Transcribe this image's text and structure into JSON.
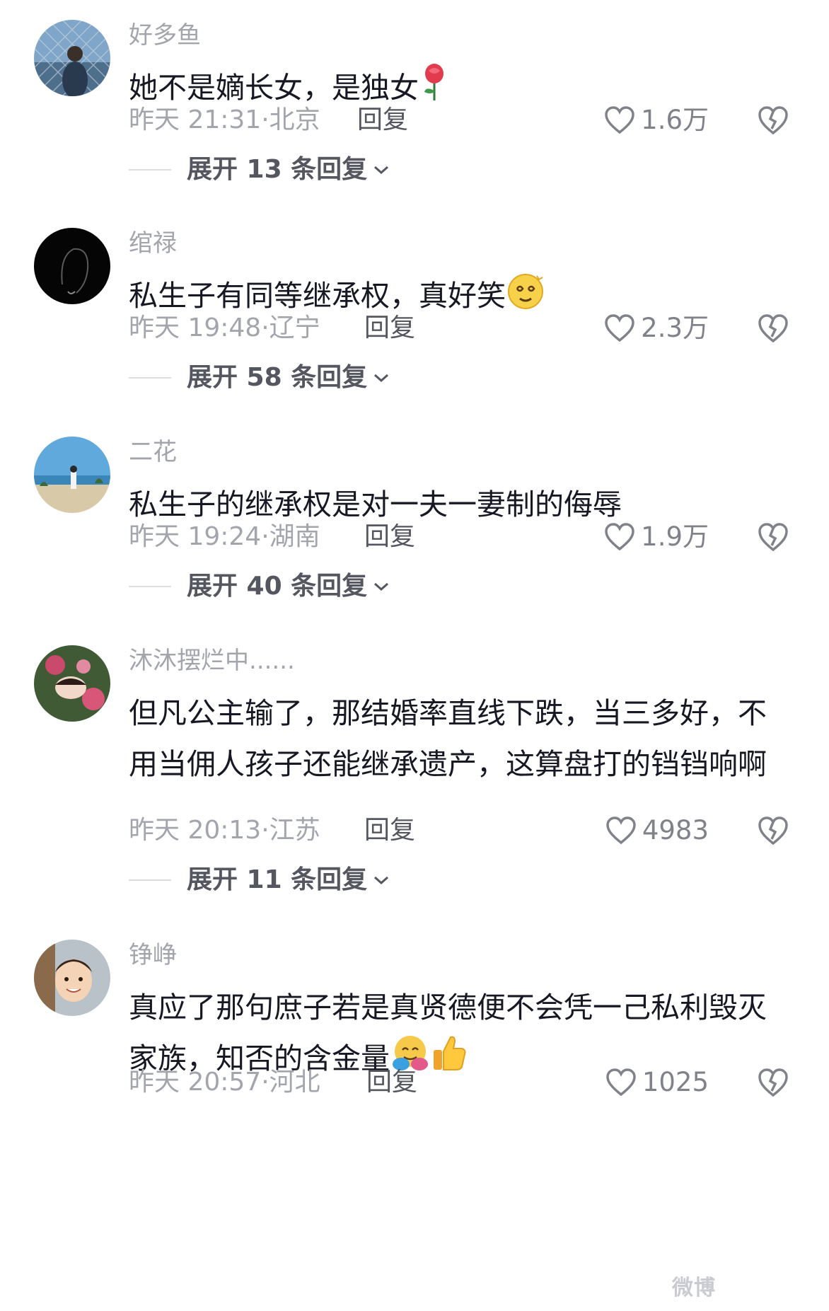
{
  "comments": [
    {
      "username": "好多鱼",
      "text": "她不是嫡长女，是独女",
      "emoji": [
        "rose-icon"
      ],
      "time": "昨天 21:31",
      "location": "北京",
      "reply_label": "回复",
      "likes": "1.6万",
      "expand_label": "展开 13 条回复"
    },
    {
      "username": "绾禄",
      "text": "私生子有同等继承权，真好笑",
      "emoji": [
        "dizzy-face-icon"
      ],
      "time": "昨天 19:48",
      "location": "辽宁",
      "reply_label": "回复",
      "likes": "2.3万",
      "expand_label": "展开 58 条回复"
    },
    {
      "username": "二花",
      "text": "私生子的继承权是对一夫一妻制的侮辱",
      "emoji": [],
      "time": "昨天 19:24",
      "location": "湖南",
      "reply_label": "回复",
      "likes": "1.9万",
      "expand_label": "展开 40 条回复"
    },
    {
      "username": "沐沐摆烂中......",
      "text": "但凡公主输了，那结婚率直线下跌，当三多好，不用当佣人孩子还能继承遗产，这算盘打的铛铛响啊",
      "emoji": [],
      "time": "昨天 20:13",
      "location": "江苏",
      "reply_label": "回复",
      "likes": "4983",
      "expand_label": "展开 11 条回复"
    },
    {
      "username": "铮峥",
      "text": "真应了那句庶子若是真贤德便不会凭一己私利毁灭家族，知否的含金量",
      "emoji": [
        "hugging-face-icon",
        "thumbs-up-icon"
      ],
      "time": "昨天 20:57",
      "location": "河北",
      "reply_label": "回复",
      "likes": "1025",
      "expand_label": ""
    }
  ],
  "meta_separator": "·",
  "watermark": "微博"
}
